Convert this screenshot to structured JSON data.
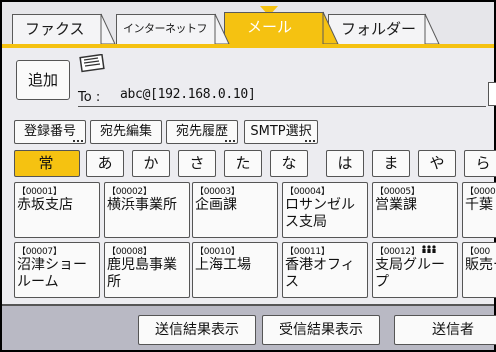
{
  "tabs": [
    {
      "label": "ファクス",
      "active": false
    },
    {
      "label": "インターネットファクス",
      "active": false
    },
    {
      "label": "メール",
      "active": true
    },
    {
      "label": "フォルダー",
      "active": false
    }
  ],
  "destination": {
    "add_label": "追加",
    "to_label": "To :",
    "to_value": "abc@[192.168.0.10]"
  },
  "function_buttons": [
    "登録番号",
    "宛先編集",
    "宛先履歴",
    "SMTP選択"
  ],
  "index_tabs": [
    "常 用",
    "あ",
    "か",
    "さ",
    "た",
    "な",
    "は",
    "ま",
    "や",
    "ら"
  ],
  "entries": [
    {
      "code": "【00001】",
      "name": "赤坂支店"
    },
    {
      "code": "【00002】",
      "name": "横浜事業所"
    },
    {
      "code": "【00003】",
      "name": "企画課"
    },
    {
      "code": "【00004】",
      "name": "ロサンゼルス支局"
    },
    {
      "code": "【00005】",
      "name": "営業課"
    },
    {
      "code": "【0000",
      "name": "千葉"
    },
    {
      "code": "【00007】",
      "name": "沼津ショールーム"
    },
    {
      "code": "【00008】",
      "name": "鹿児島事業所"
    },
    {
      "code": "【00010】",
      "name": "上海工場"
    },
    {
      "code": "【00011】",
      "name": "香港オフィス"
    },
    {
      "code": "【00012】",
      "name": "支局グループ",
      "group_icon": true
    },
    {
      "code": "【000",
      "name": "販売ープ"
    }
  ],
  "bottom_buttons": [
    "送信結果表示",
    "受信結果表示",
    "送信者"
  ],
  "colors": {
    "accent": "#f5c211",
    "panel": "#ececf0"
  }
}
